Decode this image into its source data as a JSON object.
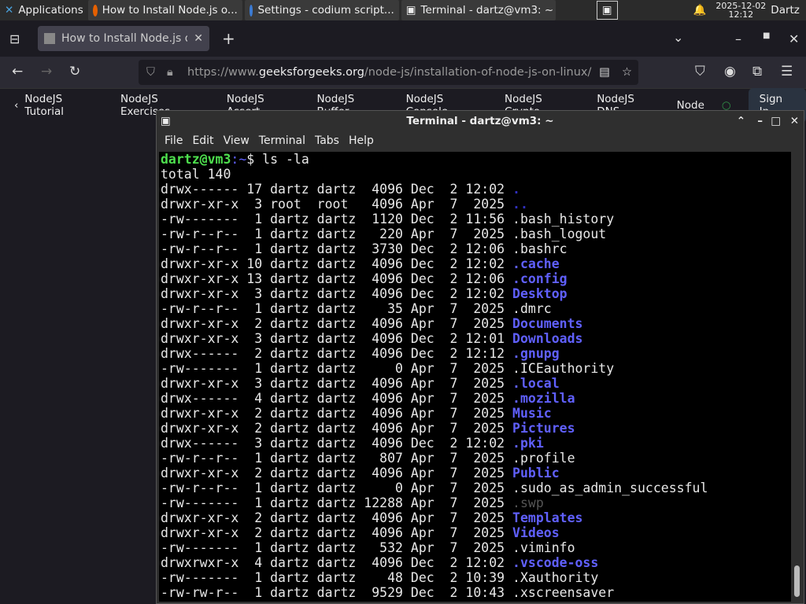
{
  "taskbar": {
    "apps": "Applications",
    "windows": [
      "How to Install Node.js o...",
      "Settings - codium script...",
      "Terminal - dartz@vm3: ~"
    ],
    "date": "2025-12-02",
    "time": "12:12",
    "user": "Dartz"
  },
  "browser": {
    "tab_title": "How to Install Node.js on",
    "url_prefix": "https://www.",
    "url_domain": "geeksforgeeks.org",
    "url_path": "/node-js/installation-of-node-js-on-linux/",
    "bookmarks": [
      "NodeJS Tutorial",
      "NodeJS Exercises",
      "NodeJS Assert",
      "NodeJS Buffer",
      "NodeJS Console",
      "NodeJS Crypto",
      "NodeJS DNS",
      "Node"
    ],
    "signin": "Sign In"
  },
  "terminal": {
    "title": "Terminal - dartz@vm3: ~",
    "menus": [
      "File",
      "Edit",
      "View",
      "Terminal",
      "Tabs",
      "Help"
    ],
    "prompt_user": "dartz@vm3",
    "prompt_path": ":~",
    "prompt_sym": "$ ",
    "command": "ls -la",
    "total": "total 140",
    "rows": [
      {
        "meta": "drwx------ 17 dartz dartz  4096 Dec  2 12:02 ",
        "name": ".",
        "type": "dir"
      },
      {
        "meta": "drwxr-xr-x  3 root  root   4096 Apr  7  2025 ",
        "name": "..",
        "type": "dir"
      },
      {
        "meta": "-rw-------  1 dartz dartz  1120 Dec  2 11:56 ",
        "name": ".bash_history",
        "type": "file"
      },
      {
        "meta": "-rw-r--r--  1 dartz dartz   220 Apr  7  2025 ",
        "name": ".bash_logout",
        "type": "file"
      },
      {
        "meta": "-rw-r--r--  1 dartz dartz  3730 Dec  2 12:06 ",
        "name": ".bashrc",
        "type": "file"
      },
      {
        "meta": "drwxr-xr-x 10 dartz dartz  4096 Dec  2 12:02 ",
        "name": ".cache",
        "type": "dir"
      },
      {
        "meta": "drwxr-xr-x 13 dartz dartz  4096 Dec  2 12:06 ",
        "name": ".config",
        "type": "dir"
      },
      {
        "meta": "drwxr-xr-x  3 dartz dartz  4096 Dec  2 12:02 ",
        "name": "Desktop",
        "type": "dir"
      },
      {
        "meta": "-rw-r--r--  1 dartz dartz    35 Apr  7  2025 ",
        "name": ".dmrc",
        "type": "file"
      },
      {
        "meta": "drwxr-xr-x  2 dartz dartz  4096 Apr  7  2025 ",
        "name": "Documents",
        "type": "dir"
      },
      {
        "meta": "drwxr-xr-x  3 dartz dartz  4096 Dec  2 12:01 ",
        "name": "Downloads",
        "type": "dir"
      },
      {
        "meta": "drwx------  2 dartz dartz  4096 Dec  2 12:12 ",
        "name": ".gnupg",
        "type": "dir"
      },
      {
        "meta": "-rw-------  1 dartz dartz     0 Apr  7  2025 ",
        "name": ".ICEauthority",
        "type": "file"
      },
      {
        "meta": "drwxr-xr-x  3 dartz dartz  4096 Apr  7  2025 ",
        "name": ".local",
        "type": "dir"
      },
      {
        "meta": "drwx------  4 dartz dartz  4096 Apr  7  2025 ",
        "name": ".mozilla",
        "type": "dir"
      },
      {
        "meta": "drwxr-xr-x  2 dartz dartz  4096 Apr  7  2025 ",
        "name": "Music",
        "type": "dir"
      },
      {
        "meta": "drwxr-xr-x  2 dartz dartz  4096 Apr  7  2025 ",
        "name": "Pictures",
        "type": "dir"
      },
      {
        "meta": "drwx------  3 dartz dartz  4096 Dec  2 12:02 ",
        "name": ".pki",
        "type": "dir"
      },
      {
        "meta": "-rw-r--r--  1 dartz dartz   807 Apr  7  2025 ",
        "name": ".profile",
        "type": "file"
      },
      {
        "meta": "drwxr-xr-x  2 dartz dartz  4096 Apr  7  2025 ",
        "name": "Public",
        "type": "dir"
      },
      {
        "meta": "-rw-r--r--  1 dartz dartz     0 Apr  7  2025 ",
        "name": ".sudo_as_admin_successful",
        "type": "file"
      },
      {
        "meta": "-rw-------  1 dartz dartz 12288 Apr  7  2025 ",
        "name": ".swp",
        "type": "dim"
      },
      {
        "meta": "drwxr-xr-x  2 dartz dartz  4096 Apr  7  2025 ",
        "name": "Templates",
        "type": "dir"
      },
      {
        "meta": "drwxr-xr-x  2 dartz dartz  4096 Apr  7  2025 ",
        "name": "Videos",
        "type": "dir"
      },
      {
        "meta": "-rw-------  1 dartz dartz   532 Apr  7  2025 ",
        "name": ".viminfo",
        "type": "file"
      },
      {
        "meta": "drwxrwxr-x  4 dartz dartz  4096 Dec  2 12:02 ",
        "name": ".vscode-oss",
        "type": "dir"
      },
      {
        "meta": "-rw-------  1 dartz dartz    48 Dec  2 10:39 ",
        "name": ".Xauthority",
        "type": "file"
      },
      {
        "meta": "-rw-rw-r--  1 dartz dartz  9529 Dec  2 10:43 ",
        "name": ".xscreensaver",
        "type": "file"
      }
    ]
  }
}
